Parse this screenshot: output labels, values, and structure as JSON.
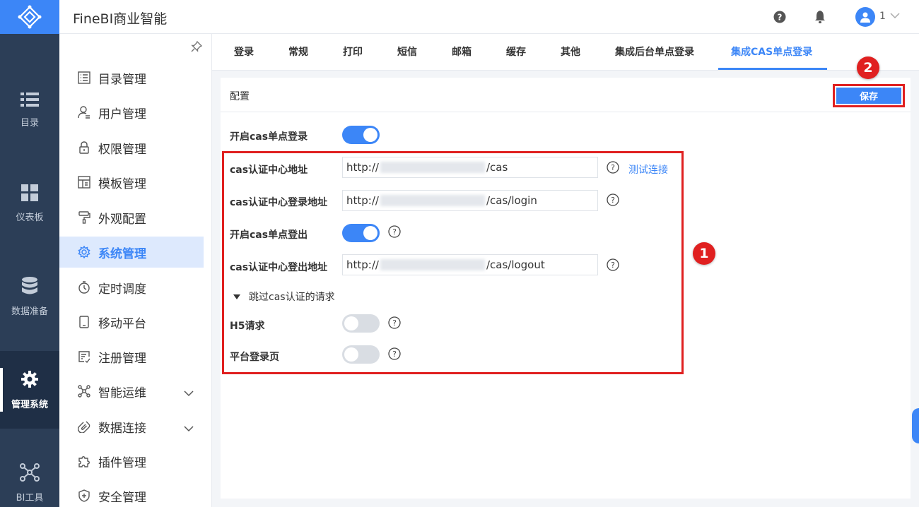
{
  "app": {
    "title": "FineBI商业智能"
  },
  "rail": [
    {
      "label": "目录",
      "icon": "list-icon"
    },
    {
      "label": "仪表板",
      "icon": "dashboard-icon"
    },
    {
      "label": "数据准备",
      "icon": "database-icon"
    },
    {
      "label": "管理系统",
      "icon": "gear-icon",
      "active": true
    },
    {
      "label": "BI工具",
      "icon": "nodes-icon"
    }
  ],
  "header": {
    "user_number": "1"
  },
  "sidebar": {
    "items": [
      {
        "label": "目录管理"
      },
      {
        "label": "用户管理"
      },
      {
        "label": "权限管理"
      },
      {
        "label": "模板管理"
      },
      {
        "label": "外观配置"
      },
      {
        "label": "系统管理",
        "active": true
      },
      {
        "label": "定时调度"
      },
      {
        "label": "移动平台"
      },
      {
        "label": "注册管理"
      },
      {
        "label": "智能运维",
        "expandable": true
      },
      {
        "label": "数据连接",
        "expandable": true
      },
      {
        "label": "插件管理"
      },
      {
        "label": "安全管理"
      }
    ]
  },
  "tabs": [
    "登录",
    "常规",
    "打印",
    "短信",
    "邮箱",
    "缓存",
    "其他",
    "集成后台单点登录",
    "集成CAS单点登录"
  ],
  "active_tab": "集成CAS单点登录",
  "panel": {
    "title": "配置",
    "save_label": "保存",
    "fields": {
      "enable_sso": {
        "label": "开启cas单点登录",
        "on": true
      },
      "cas_url": {
        "label": "cas认证中心地址",
        "prefix": "http://",
        "suffix": "/cas",
        "test_link": "测试连接"
      },
      "cas_login_url": {
        "label": "cas认证中心登录地址",
        "prefix": "http://",
        "suffix": "/cas/login"
      },
      "enable_logout": {
        "label": "开启cas单点登出",
        "on": true
      },
      "cas_logout_url": {
        "label": "cas认证中心登出地址",
        "prefix": "http://",
        "suffix": "/cas/logout"
      },
      "skip_section": {
        "label": "跳过cas认证的请求"
      },
      "h5_request": {
        "label": "H5请求",
        "on": false
      },
      "platform_login": {
        "label": "平台登录页",
        "on": false
      }
    }
  },
  "annotations": {
    "badge_1": "1",
    "badge_2": "2"
  },
  "colors": {
    "accent": "#3c86f7",
    "rail": "#2c3e57",
    "annotation": "#e02020"
  }
}
